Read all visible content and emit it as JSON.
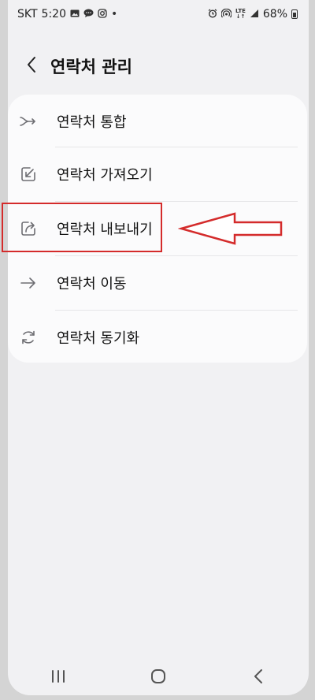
{
  "status_bar": {
    "carrier": "SKT",
    "time": "5:20",
    "network": "LTE",
    "battery": "68%"
  },
  "header": {
    "title": "연락처 관리",
    "back_icon": "chevron-left-icon"
  },
  "menu": {
    "items": [
      {
        "label": "연락처 통합",
        "icon": "merge-icon"
      },
      {
        "label": "연락처 가져오기",
        "icon": "import-icon"
      },
      {
        "label": "연락처 내보내기",
        "icon": "export-icon"
      },
      {
        "label": "연락처 이동",
        "icon": "move-arrow-icon"
      },
      {
        "label": "연락처 동기화",
        "icon": "sync-icon"
      }
    ]
  },
  "annotation": {
    "highlighted_item": "연락처 내보내기",
    "color": "#d42b2b"
  },
  "nav": {
    "recents_icon": "recents-icon",
    "home_icon": "home-icon",
    "back_icon": "back-icon"
  }
}
